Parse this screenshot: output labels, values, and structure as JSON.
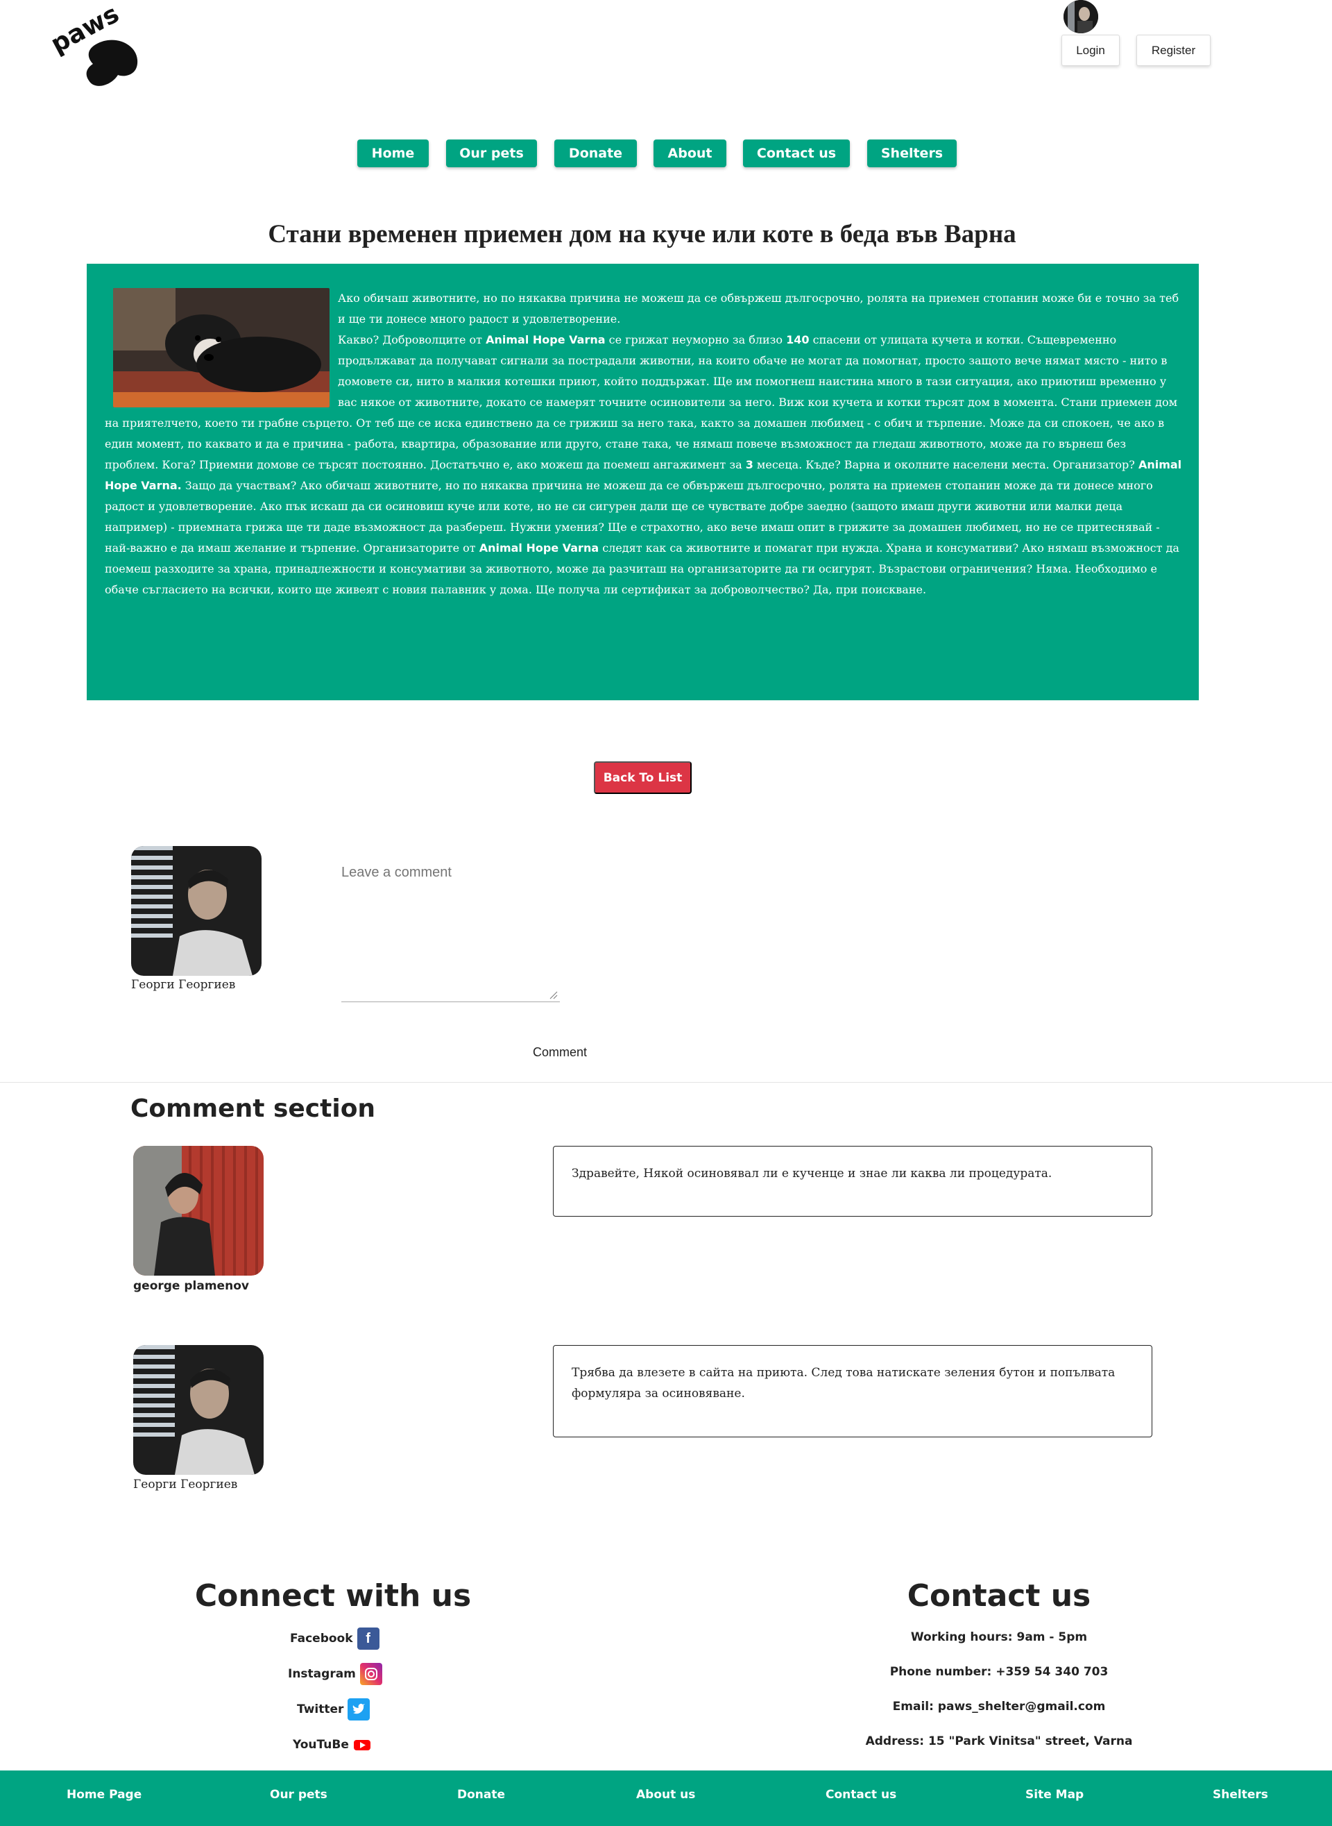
{
  "header": {
    "logo_text": "paws",
    "login_label": "Login",
    "register_label": "Register"
  },
  "nav": {
    "items": [
      {
        "label": "Home"
      },
      {
        "label": "Our pets"
      },
      {
        "label": "Donate"
      },
      {
        "label": "About"
      },
      {
        "label": "Contact us"
      },
      {
        "label": "Shelters"
      }
    ]
  },
  "article": {
    "title": "Стани временен приемен дом на куче или коте в беда във Варна",
    "p1": "Ако обичаш животните, но по някаква причина не можеш да се обвържеш дългосрочно, ролята на приемен стопанин може би е точно за теб и ще ти донесе много радост и удовлетворение.",
    "p2a": "Какво? Доброволците от ",
    "org1": "Animal Hope Varna",
    "p2b": " се грижат неуморно за близо ",
    "count": "140",
    "p2c": " спасени от улицата кучета и котки. Същевременно продължават да получават сигнали за пострадали животни, на които обаче не могат да помогнат, просто защото вече нямат място - нито в домовете си, нито в малкия котешки приют, който поддържат. Ще им помогнеш наистина много в тази ситуация, ако приютиш временно у вас някое от животните, докато се намерят точните осиновители за него. Виж кои кучета и котки търсят дом в момента. Стани приемен дом на приятелчето, което ти грабне сърцето. От теб ще се иска единствено да се грижиш за него така, както за домашен любимец - с обич и търпение. Може да си спокоен, че ако в един момент, по каквато и да е причина - работа, квартира, образование или друго, стане така, че нямаш повече възможност да гледаш животното, може да го върнеш без проблем. Кога? Приемни домове се търсят постоянно. Достатъчно е, ако можеш да поемеш ангажимент за ",
    "months": "3",
    "p2d": " месеца. Къде? Варна и околните населени места. Организатор? ",
    "org2": "Animal Hope Varna.",
    "p2e": " Защо да участвам? Ако обичаш животните, но по някаква причина не можеш да се обвържеш дългосрочно, ролята на приемен стопанин може да ти донесе много радост и удовлетворение. Ако пък искаш да си осиновиш куче или коте, но не си сигурен дали ще се чувствате добре заедно (защото имаш други животни или малки деца например) - приемната грижа ще ти даде възможност да разбереш. Нужни умения? Ще е страхотно, ако вече имаш опит в грижите за домашен любимец, но не се притеснявай - най-важно е да имаш желание и търпение. Организаторите от ",
    "org3": "Animal Hope Varna",
    "p2f": " следят как са животните и помагат при нужда. Храна и консумативи? Ако нямаш възможност да поемеш разходите за храна, принадлежности и консумативи за животното, може да разчиташ на организаторите да ги осигурят. Възрастови ограничения? Няма. Необходимо е обаче съгласието на всички, които ще живеят с новия палавник у дома. Ще получа ли сертификат за доброволчество? Да, при поискване."
  },
  "back_label": "Back To List",
  "composer": {
    "user_name": "Георги Георгиев",
    "placeholder": "Leave a comment",
    "submit_label": "Comment"
  },
  "comments": {
    "title": "Comment section",
    "items": [
      {
        "author": "george plamenov",
        "text": "Здравейте, Някой осиновявал ли е кученце и знае ли каква ли процедурата."
      },
      {
        "author": "Георги Георгиев",
        "text": "Трябва да влезете в сайта на приюта. След това натискате зеления бутон и попълвата формуляра за осиновяване."
      }
    ]
  },
  "connect": {
    "title": "Connect with us",
    "links": [
      {
        "label": "Facebook",
        "icon": "facebook-icon",
        "color": "#3b5998"
      },
      {
        "label": "Instagram",
        "icon": "instagram-icon",
        "color": "#e1306c"
      },
      {
        "label": "Twitter",
        "icon": "twitter-icon",
        "color": "#1da1f2"
      },
      {
        "label": "YouTuBe",
        "icon": "youtube-icon",
        "color": "#ff0000"
      }
    ]
  },
  "contact": {
    "title": "Contact us",
    "hours": "Working hours: 9am - 5pm",
    "phone": "Phone number: +359 54 340 703",
    "email": "Email: paws_shelter@gmail.com",
    "address": "Address: 15 \"Park Vinitsa\" street, Varna"
  },
  "footer": {
    "links": [
      {
        "label": "Home Page"
      },
      {
        "label": "Our pets"
      },
      {
        "label": "Donate"
      },
      {
        "label": "About us"
      },
      {
        "label": "Contact us"
      },
      {
        "label": "Site Map"
      },
      {
        "label": "Shelters"
      }
    ]
  },
  "colors": {
    "primary": "#00a482",
    "danger": "#dc3545"
  }
}
